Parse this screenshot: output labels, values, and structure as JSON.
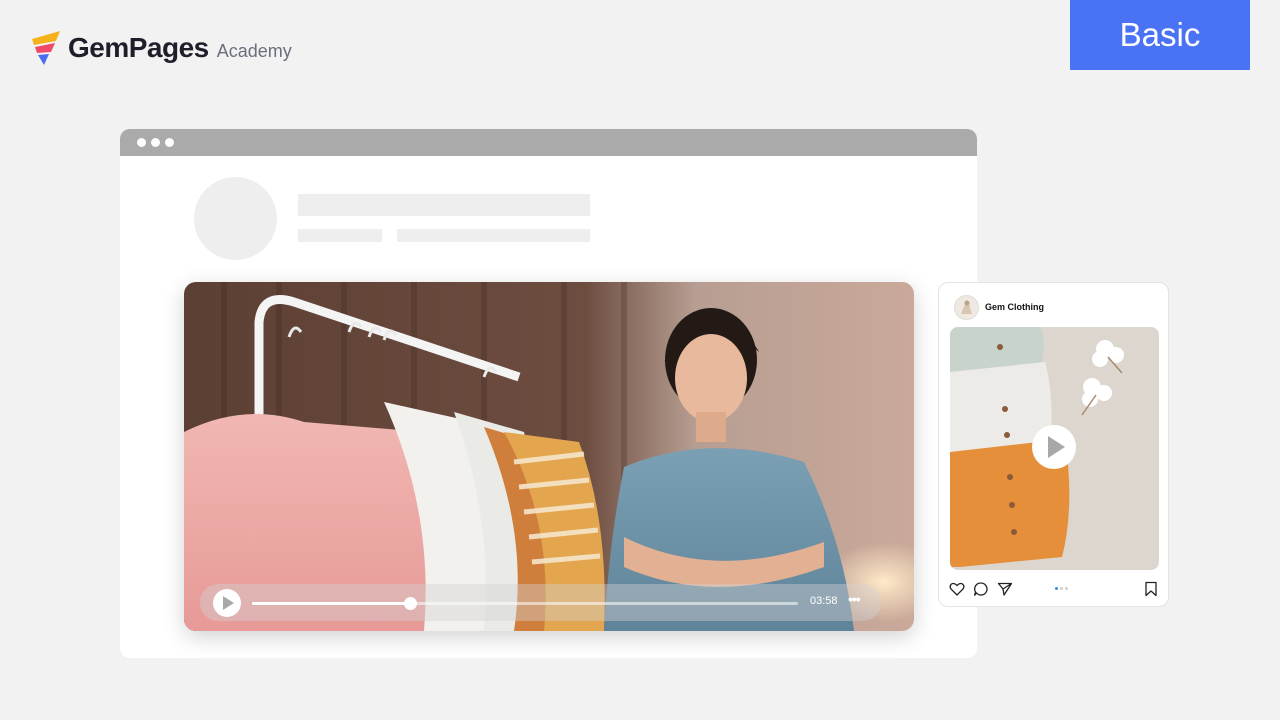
{
  "brand": {
    "name": "GemPages",
    "sub": "Academy"
  },
  "badge": {
    "label": "Basic",
    "color": "#4a72f5"
  },
  "browser": {
    "window_dots": 3
  },
  "video": {
    "current_time": "03:58",
    "progress": 0.29,
    "play_icon": "play-icon",
    "more_icon": "more-horizontal-icon"
  },
  "post": {
    "account_name": "Gem Clothing",
    "actions": [
      "heart-icon",
      "comment-icon",
      "share-icon",
      "bookmark-icon"
    ],
    "carousel": {
      "count": 3,
      "active": 0
    }
  }
}
